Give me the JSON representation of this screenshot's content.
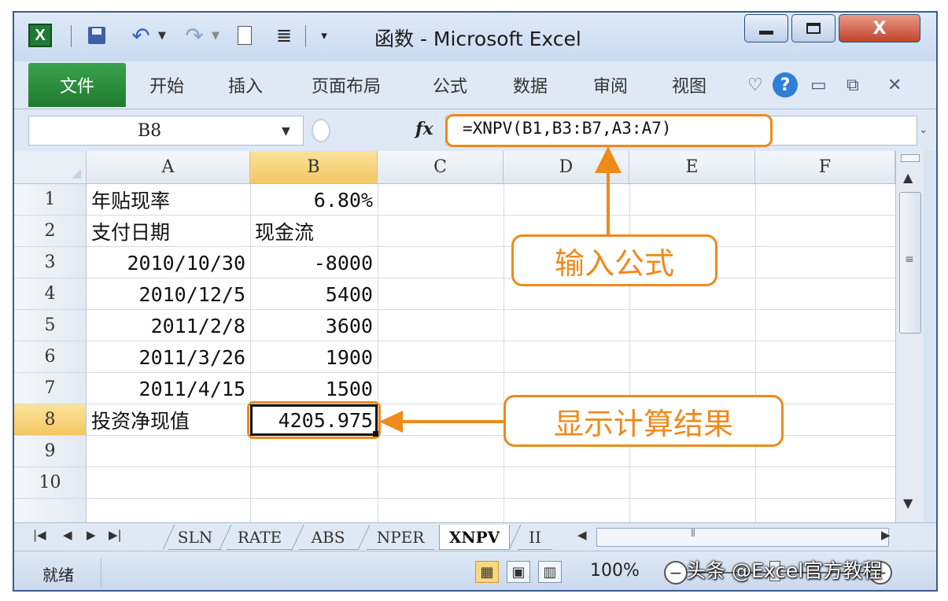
{
  "window": {
    "title": "函数 - Microsoft Excel",
    "app_icon": "X",
    "close_symbol": "X"
  },
  "quick_access": {
    "icons": [
      "excel-icon",
      "save-icon",
      "undo-icon",
      "redo-icon",
      "new-document-icon",
      "align-icon",
      "customize-icon"
    ]
  },
  "ribbon": {
    "file_tab": "文件",
    "tabs": [
      "开始",
      "插入",
      "页面布局",
      "公式",
      "数据",
      "审阅",
      "视图"
    ],
    "help_symbol": "?"
  },
  "formula_bar": {
    "name_box": "B8",
    "fx_label": "fx",
    "formula": "=XNPV(B1,B3:B7,A3:A7)"
  },
  "sheet": {
    "columns": [
      "A",
      "B",
      "C",
      "D",
      "E",
      "F"
    ],
    "selected_column": "B",
    "selected_row": "8",
    "rows": [
      {
        "num": "1",
        "a": "年贴现率",
        "b": "6.80%"
      },
      {
        "num": "2",
        "a": "支付日期",
        "b": "现金流"
      },
      {
        "num": "3",
        "a": "2010/10/30",
        "b": "-8000"
      },
      {
        "num": "4",
        "a": "2010/12/5",
        "b": "5400"
      },
      {
        "num": "5",
        "a": "2011/2/8",
        "b": "3600"
      },
      {
        "num": "6",
        "a": "2011/3/26",
        "b": "1900"
      },
      {
        "num": "7",
        "a": "2011/4/15",
        "b": "1500"
      },
      {
        "num": "8",
        "a": "投资净现值",
        "b": "4205.975"
      },
      {
        "num": "9",
        "a": "",
        "b": ""
      },
      {
        "num": "10",
        "a": "",
        "b": ""
      }
    ]
  },
  "sheet_tabs": {
    "tabs": [
      "SLN",
      "RATE",
      "ABS",
      "NPER",
      "XNPV",
      "II"
    ],
    "active": "XNPV"
  },
  "status_bar": {
    "status": "就绪",
    "zoom": "100%"
  },
  "callouts": {
    "formula_callout": "输入公式",
    "result_callout": "显示计算结果"
  },
  "watermark": "头条 @Excel官方教程",
  "colors": {
    "accent_orange": "#ef8a1b",
    "file_tab_green": "#1f7a2e",
    "selected_header": "#f4c762"
  }
}
